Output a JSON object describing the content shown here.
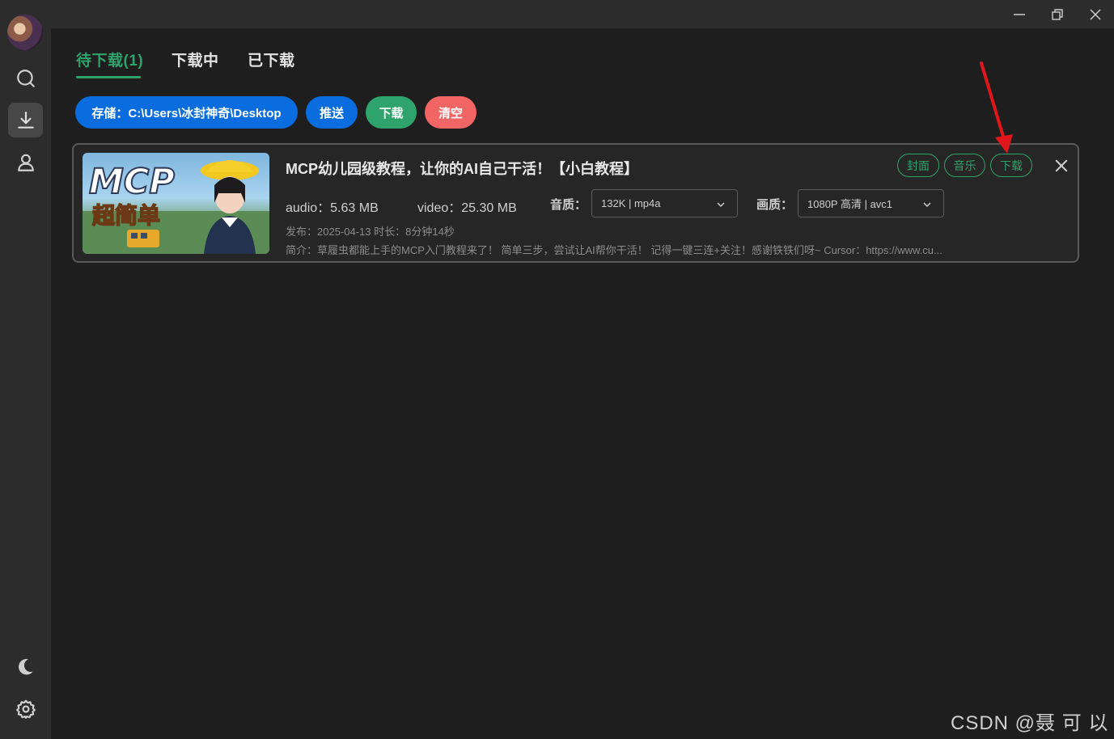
{
  "tabs": [
    {
      "label": "待下载(1)"
    },
    {
      "label": "下载中"
    },
    {
      "label": "已下载"
    }
  ],
  "actions": {
    "storage": "存储：C:\\Users\\冰封神奇\\Desktop",
    "push": "推送",
    "download": "下载",
    "clear": "清空"
  },
  "item": {
    "thumbnail": {
      "line1": "MCP",
      "line2": "超简单"
    },
    "title": "MCP幼儿园级教程，让你的AI自己干活！【小白教程】",
    "chips": {
      "cover": "封面",
      "music": "音乐",
      "download": "下载"
    },
    "audio": "audio：5.63 MB",
    "video": "video：25.30 MB",
    "audio_quality_label": "音质：",
    "audio_quality_value": "132K | mp4a",
    "video_quality_label": "画质：",
    "video_quality_value": "1080P 高清 | avc1",
    "publish_info": "发布：2025-04-13 时长：8分钟14秒",
    "description": "简介：草履虫都能上手的MCP入门教程来了！ 简单三步，尝试让AI帮你干活！ 记得一键三连+关注！感谢铁铁们呀~ Cursor：https://www.cu..."
  },
  "watermark": "CSDN @聂 可 以",
  "colors": {
    "accent_green": "#2ea36b",
    "primary_blue": "#0a6ddf",
    "danger_red": "#f26565",
    "arrow_red": "#e0161b"
  },
  "icons": [
    "search-icon",
    "download-icon",
    "user-icon",
    "moon-icon",
    "gear-icon",
    "minimize-icon",
    "restore-icon",
    "close-icon",
    "chevron-down-icon"
  ]
}
